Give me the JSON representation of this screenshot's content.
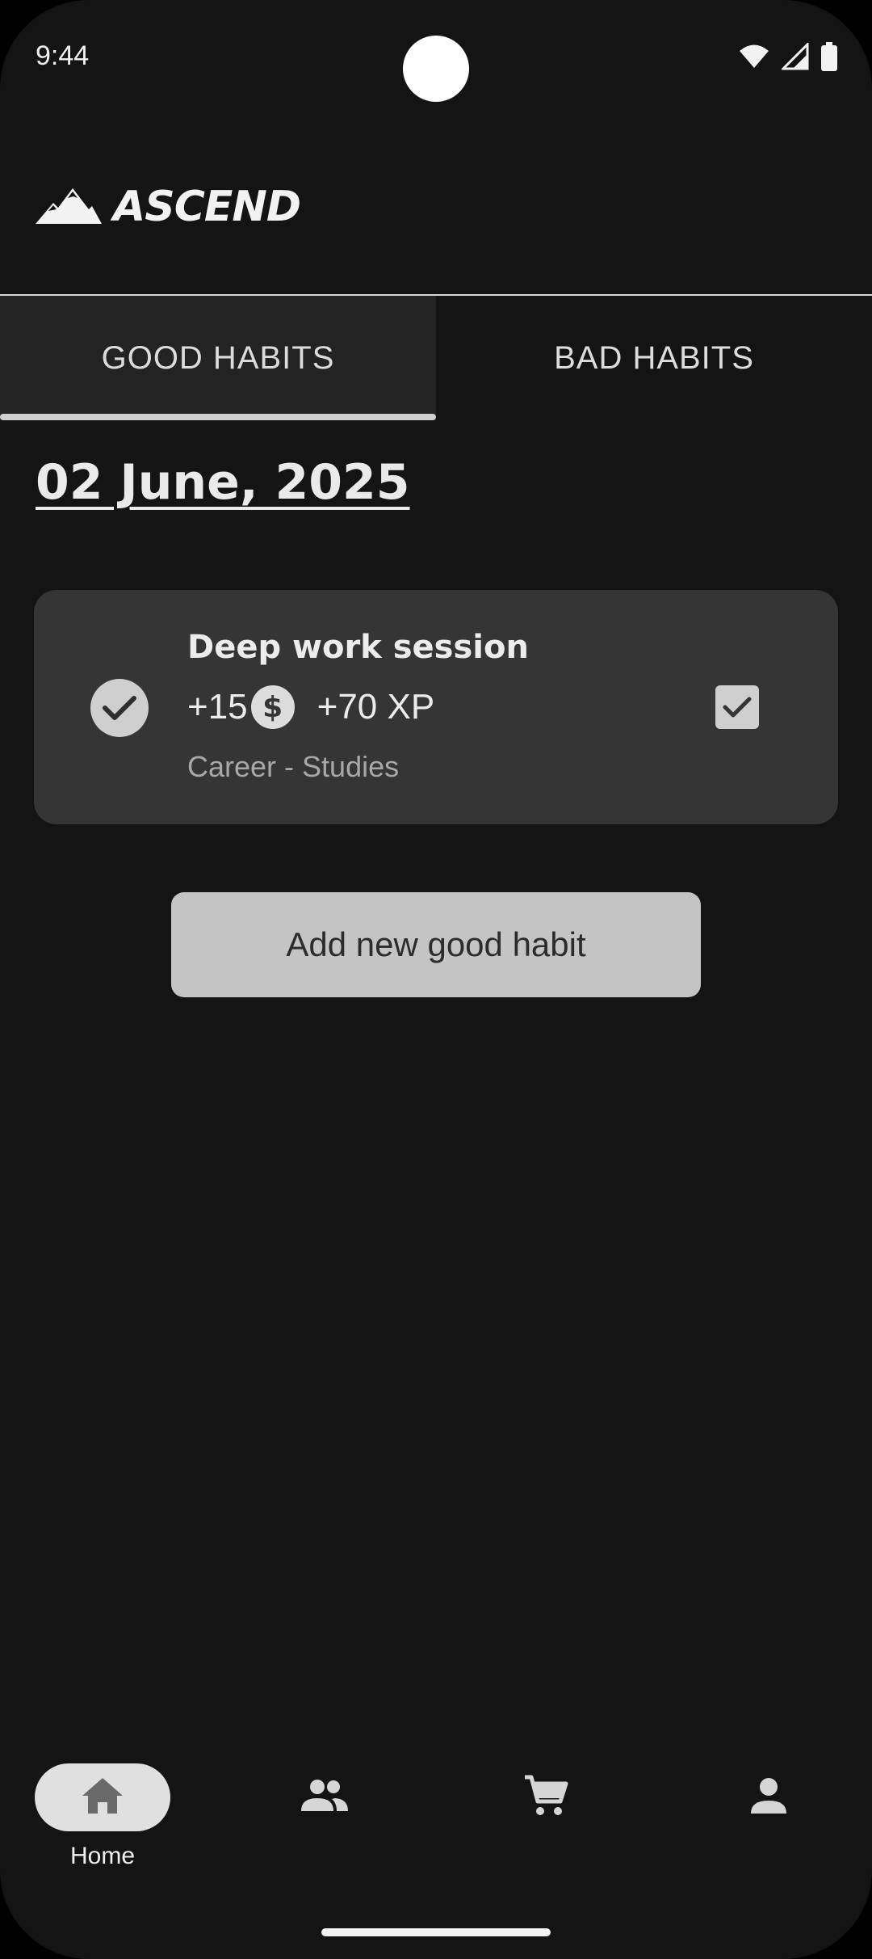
{
  "status_bar": {
    "time": "9:44",
    "icons": [
      "wifi-icon",
      "signal-icon",
      "battery-icon"
    ]
  },
  "app": {
    "name": "ASCEND",
    "logo_icon": "mountain-icon"
  },
  "tabs": [
    {
      "label": "GOOD HABITS",
      "active": true
    },
    {
      "label": "BAD HABITS",
      "active": false
    }
  ],
  "date": "02 June, 2025",
  "habits": [
    {
      "title": "Deep work session",
      "coins": "+15",
      "coin_icon": "dollar-coin-icon",
      "xp": "+70 XP",
      "category": "Career - Studies",
      "completed": true
    }
  ],
  "add_button_label": "Add new good habit",
  "bottom_nav": [
    {
      "icon": "home-icon",
      "label": "Home",
      "active": true
    },
    {
      "icon": "people-icon",
      "label": "",
      "active": false
    },
    {
      "icon": "cart-icon",
      "label": "",
      "active": false
    },
    {
      "icon": "person-icon",
      "label": "",
      "active": false
    }
  ],
  "colors": {
    "background": "#141414",
    "card": "#353535",
    "active_tab": "#232323",
    "button": "#c4c4c4",
    "text": "#e6e6e6"
  }
}
